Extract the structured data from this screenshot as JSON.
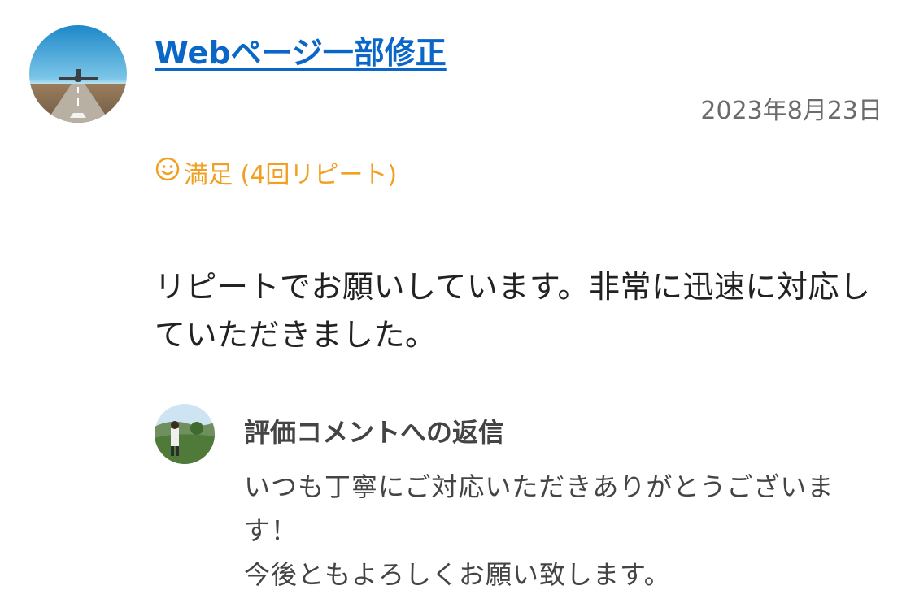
{
  "review": {
    "title": "Webページ一部修正",
    "date": "2023年8月23日",
    "rating_icon": "smile-icon",
    "rating_text": "満足 (4回リピート)",
    "rating_color": "#f0a023",
    "body": "リピートでお願いしています。非常に迅速に対応していただきました。"
  },
  "reply": {
    "title": "評価コメントへの返信",
    "lines": [
      "いつも丁寧にご対応いただきありがとうございます！",
      "今後ともよろしくお願い致します。"
    ]
  },
  "colors": {
    "link": "#0a67c8",
    "date": "#6b6b6b",
    "text": "#222222",
    "reply_text": "#444444"
  }
}
